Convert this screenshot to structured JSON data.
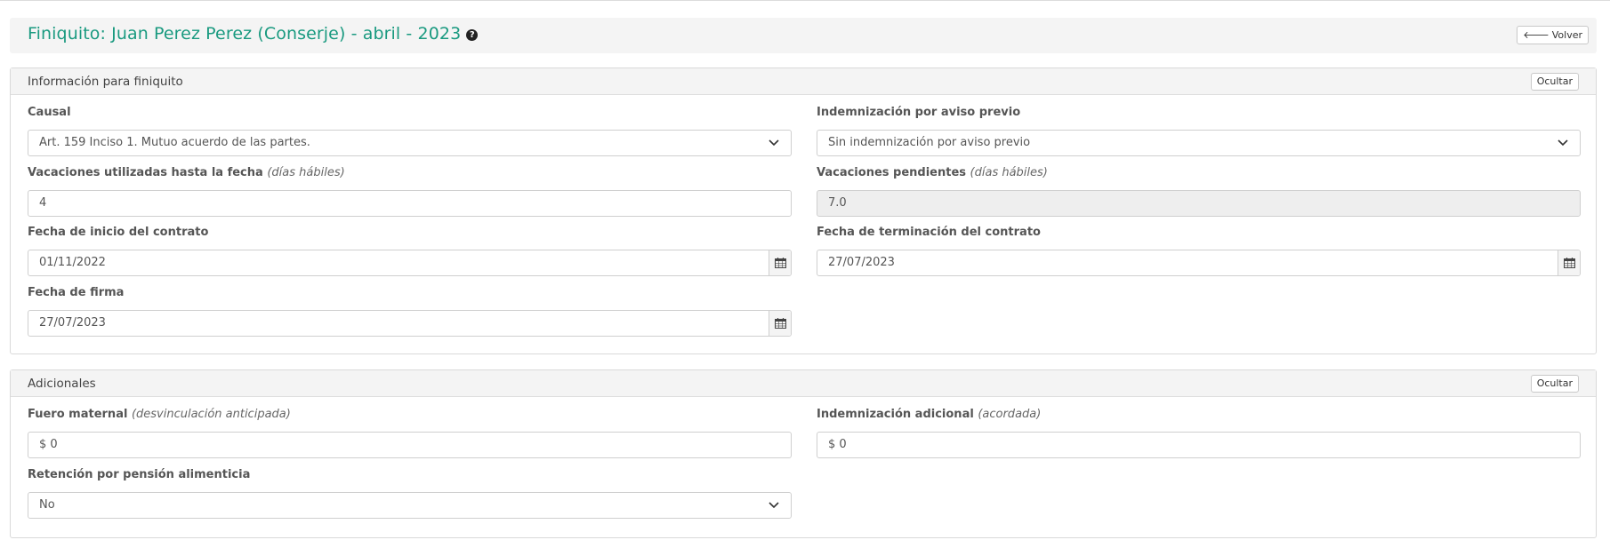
{
  "header": {
    "title": "Finiquito: Juan Perez Perez (Conserje) - abril - 2023",
    "help_icon": "question-circle-icon",
    "back_label": "Volver",
    "back_icon": "arrow-left-icon"
  },
  "info_panel": {
    "title": "Información para finiquito",
    "hide_label": "Ocultar",
    "causal": {
      "label": "Causal",
      "value": "Art. 159 Inciso 1. Mutuo acuerdo de las partes."
    },
    "aviso_previo": {
      "label": "Indemnización por aviso previo",
      "value": "Sin indemnización por aviso previo"
    },
    "vacaciones_utilizadas": {
      "label": "Vacaciones utilizadas hasta la fecha",
      "hint": "(días hábiles)",
      "value": "4"
    },
    "vacaciones_pendientes": {
      "label": "Vacaciones pendientes",
      "hint": "(días hábiles)",
      "value": "7.0"
    },
    "fecha_inicio": {
      "label": "Fecha de inicio del contrato",
      "value": "01/11/2022"
    },
    "fecha_termino": {
      "label": "Fecha de terminación del contrato",
      "value": "27/07/2023"
    },
    "fecha_firma": {
      "label": "Fecha de firma",
      "value": "27/07/2023"
    }
  },
  "extras_panel": {
    "title": "Adicionales",
    "hide_label": "Ocultar",
    "fuero_maternal": {
      "label": "Fuero maternal",
      "hint": "(desvinculación anticipada)",
      "value": "$ 0"
    },
    "indemnizacion_adicional": {
      "label": "Indemnización adicional",
      "hint": "(acordada)",
      "value": "$ 0"
    },
    "retencion_pension": {
      "label": "Retención por pensión alimenticia",
      "value": "No"
    }
  },
  "colors": {
    "title": "#1a9a80",
    "panel_header": "#f4f4f4",
    "border": "#d9d9d9",
    "readonly": "#eeeeee"
  }
}
